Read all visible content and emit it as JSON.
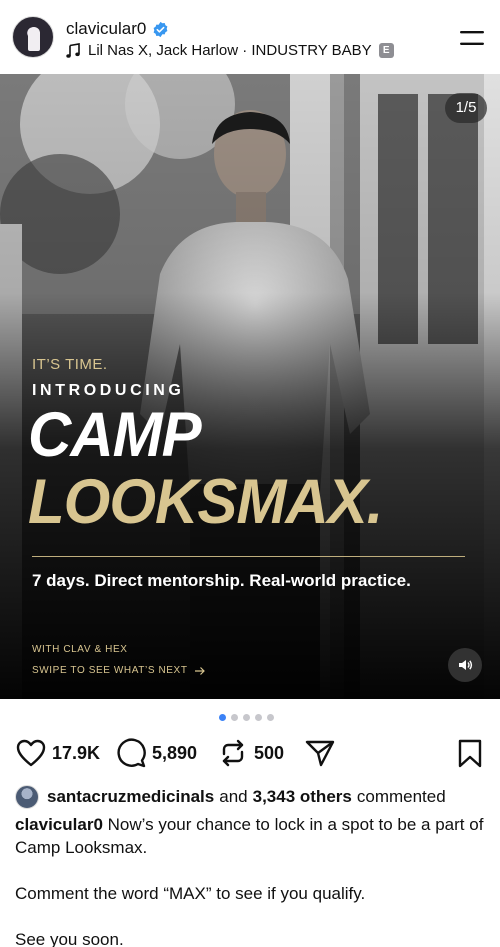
{
  "post": {
    "username": "clavicular0",
    "music": "Lil Nas X, Jack Harlow · INDUSTRY BABY",
    "explicit_badge": "E",
    "slide_counter": "1/5",
    "slides_total": 5,
    "active_slide": 1
  },
  "slide": {
    "kicker": "IT’S TIME.",
    "introducing": "INTRODUCING",
    "headline_line1": "CAMP",
    "headline_line2": "LOOKSMAX.",
    "tagline": "7 days. Direct mentorship. Real-world practice.",
    "with_line": "WITH CLAV & HEX",
    "swipe_line": "SWIPE TO SEE WHAT’S NEXT"
  },
  "actions": {
    "likes": "17.9K",
    "comments": "5,890",
    "reposts": "500"
  },
  "commented_line": {
    "user": "santacruzmedicinals",
    "and": "and",
    "others": "3,343 others",
    "suffix": "commented"
  },
  "caption": {
    "user": "clavicular0",
    "line1": "Now’s your chance to lock in a spot to be a part of Camp Looksmax.",
    "line2": "Comment the word “MAX” to see if you qualify.",
    "line3": "See you soon."
  },
  "colors": {
    "gold": "#d8c590",
    "verified": "#3897f0",
    "active_dot": "#3b82f6"
  },
  "icons": [
    "verified-icon",
    "music-note-icon",
    "menu-icon",
    "heart-icon",
    "comment-icon",
    "repost-icon",
    "share-icon",
    "bookmark-icon",
    "sound-icon",
    "arrow-right-icon"
  ]
}
